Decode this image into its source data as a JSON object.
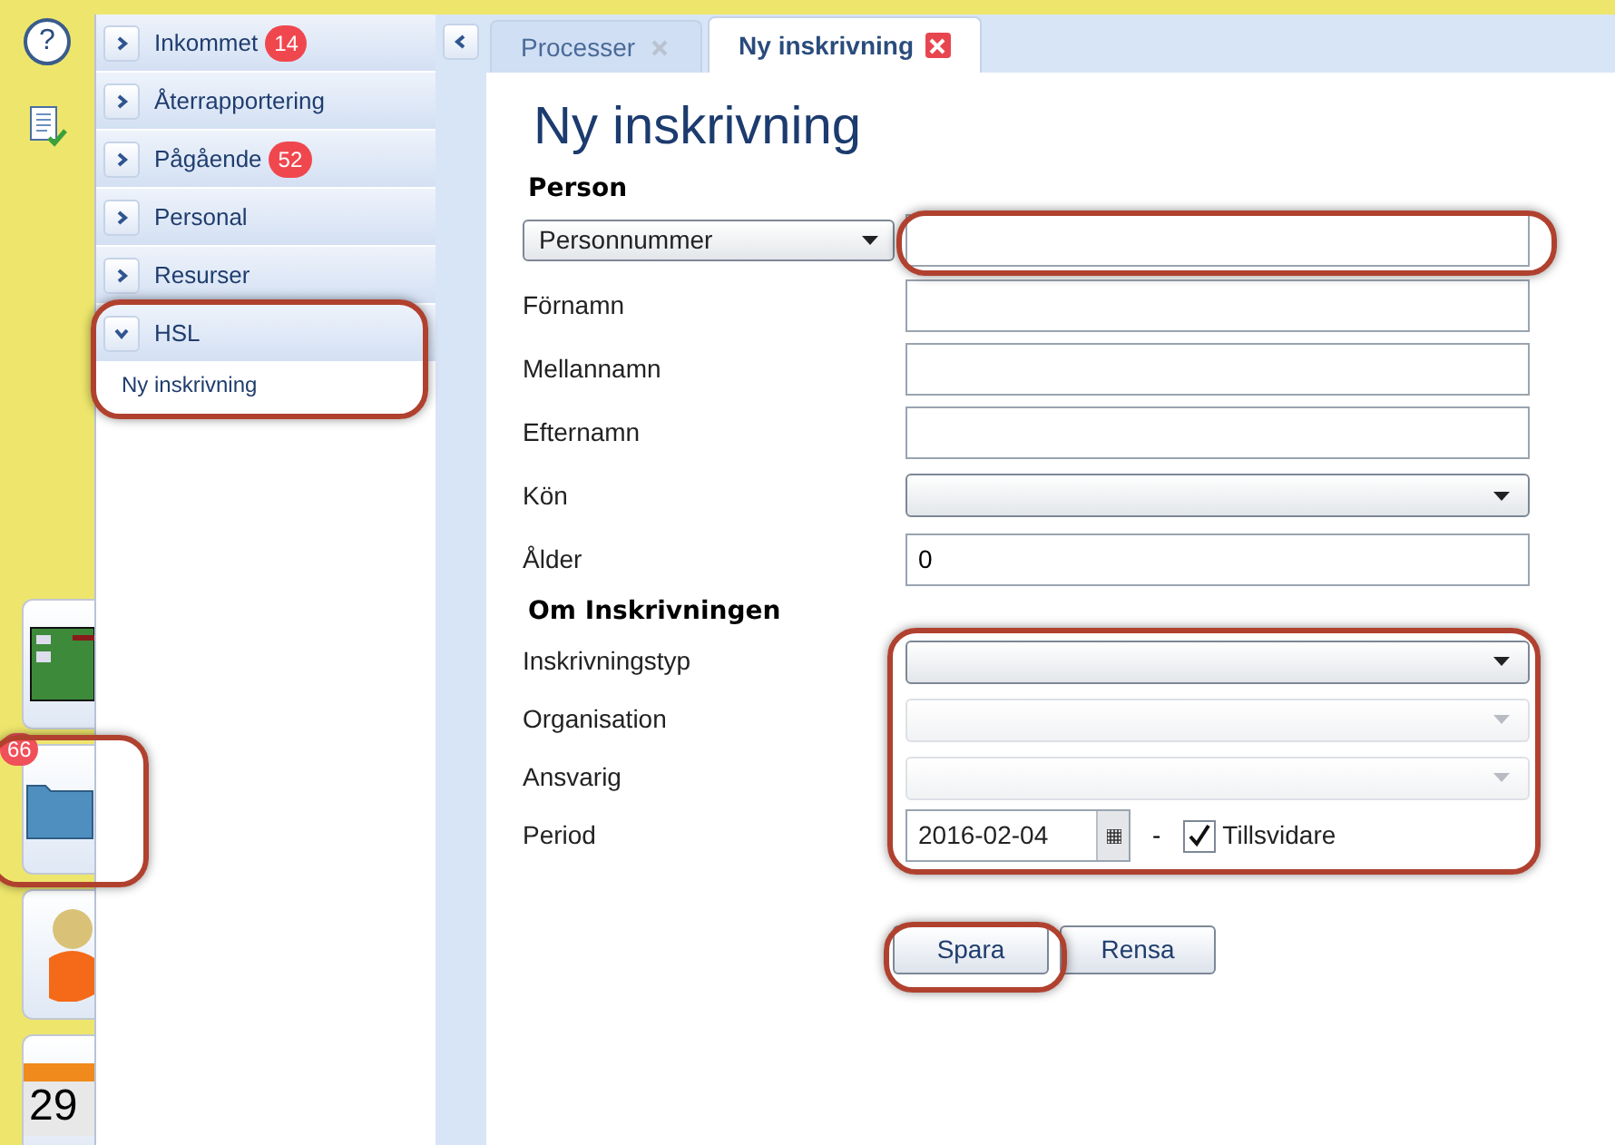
{
  "help_button": "?",
  "launcher": [
    {
      "kind": "board"
    },
    {
      "kind": "folder",
      "badge": "66"
    },
    {
      "kind": "person"
    },
    {
      "kind": "calendar",
      "day": "29"
    }
  ],
  "sidebar": {
    "groups": [
      {
        "label": "Inkommet",
        "badge": "14",
        "expanded": false
      },
      {
        "label": "Återrapportering",
        "expanded": false
      },
      {
        "label": "Pågående",
        "badge": "52",
        "expanded": false
      },
      {
        "label": "Personal",
        "expanded": false
      },
      {
        "label": "Resurser",
        "expanded": false
      },
      {
        "label": "HSL",
        "expanded": true,
        "children": [
          {
            "label": "Ny inskrivning"
          }
        ]
      }
    ]
  },
  "tabs": [
    {
      "label": "Processer",
      "selected": false
    },
    {
      "label": "Ny inskrivning",
      "selected": true
    }
  ],
  "form": {
    "title": "Ny inskrivning",
    "sections": [
      {
        "heading": "Person",
        "fields": [
          {
            "kind": "select-input",
            "select": "Personnummer"
          },
          {
            "kind": "text",
            "label": "Förnamn"
          },
          {
            "kind": "text",
            "label": "Mellannamn"
          },
          {
            "kind": "text",
            "label": "Efternamn"
          },
          {
            "kind": "select",
            "label": "Kön",
            "disabled": false
          },
          {
            "kind": "text",
            "label": "Ålder",
            "value": "0"
          }
        ]
      },
      {
        "heading": "Om Inskrivningen",
        "fields": [
          {
            "kind": "select",
            "label": "Inskrivningstyp",
            "disabled": false
          },
          {
            "kind": "select",
            "label": "Organisation",
            "disabled": true
          },
          {
            "kind": "select",
            "label": "Ansvarig",
            "disabled": true
          },
          {
            "kind": "period",
            "label": "Period",
            "value": "2016-02-04",
            "separator": "-",
            "checkbox": {
              "label": "Tillsvidare",
              "checked": true
            }
          }
        ]
      }
    ],
    "buttons": [
      "Spara",
      "Rensa"
    ]
  }
}
